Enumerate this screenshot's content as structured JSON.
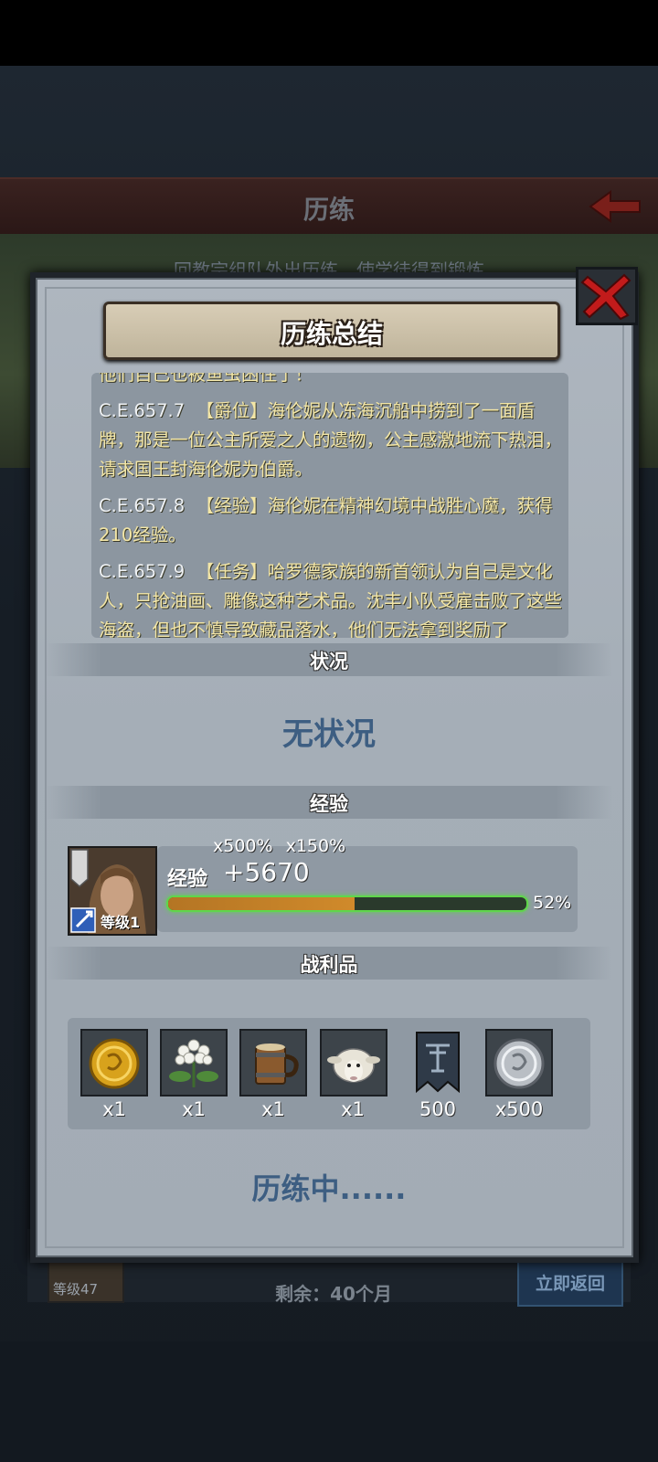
{
  "background": {
    "header_title": "历练",
    "subtitle": "回教宗组队外出历练，使学徒得到锻炼",
    "hero_level": "等级47",
    "remaining": "剩余：40个月",
    "return_button": "立即返回",
    "progress": 0.32
  },
  "modal": {
    "title": "历练总结",
    "log_entries": [
      {
        "date": "",
        "text": "他们自己也被鱼虫困住了！"
      },
      {
        "date": "C.E.657.7",
        "text": "【爵位】海伦妮从冻海沉船中捞到了一面盾牌，那是一位公主所爱之人的遗物，公主感激地流下热泪，请求国王封海伦妮为伯爵。"
      },
      {
        "date": "C.E.657.8",
        "text": "【经验】海伦妮在精神幻境中战胜心魔，获得210经验。"
      },
      {
        "date": "C.E.657.9",
        "text": "【任务】哈罗德家族的新首领认为自己是文化人，只抢油画、雕像这种艺术品。沈丰小队受雇击败了这些海盗，但也不慎导致藏品落水，他们无法拿到奖励了"
      }
    ],
    "status_section": {
      "label": "状况",
      "value": "无状况"
    },
    "exp_section": {
      "label": "经验",
      "hero_level": "等级1",
      "multipliers": [
        "x500%",
        "x150%"
      ],
      "exp_label": "经验",
      "exp_gain": "+5670",
      "progress": 0.52,
      "progress_text": "52%"
    },
    "loot_section": {
      "label": "战利品",
      "items": [
        {
          "icon": "gold-coin-icon",
          "count": "x1"
        },
        {
          "icon": "white-flower-icon",
          "count": "x1"
        },
        {
          "icon": "wooden-mug-icon",
          "count": "x1"
        },
        {
          "icon": "sheep-icon",
          "count": "x1"
        },
        {
          "icon": "banner-icon",
          "count": "500"
        },
        {
          "icon": "silver-coin-icon",
          "count": "x500"
        }
      ]
    },
    "training_status": "历练中......"
  },
  "colors": {
    "accent_blue": "#3d5e82",
    "log_text": "#f3e6a6",
    "exp_bar_glow": "#5fd64b",
    "exp_bar_fill": "#c8822a"
  }
}
